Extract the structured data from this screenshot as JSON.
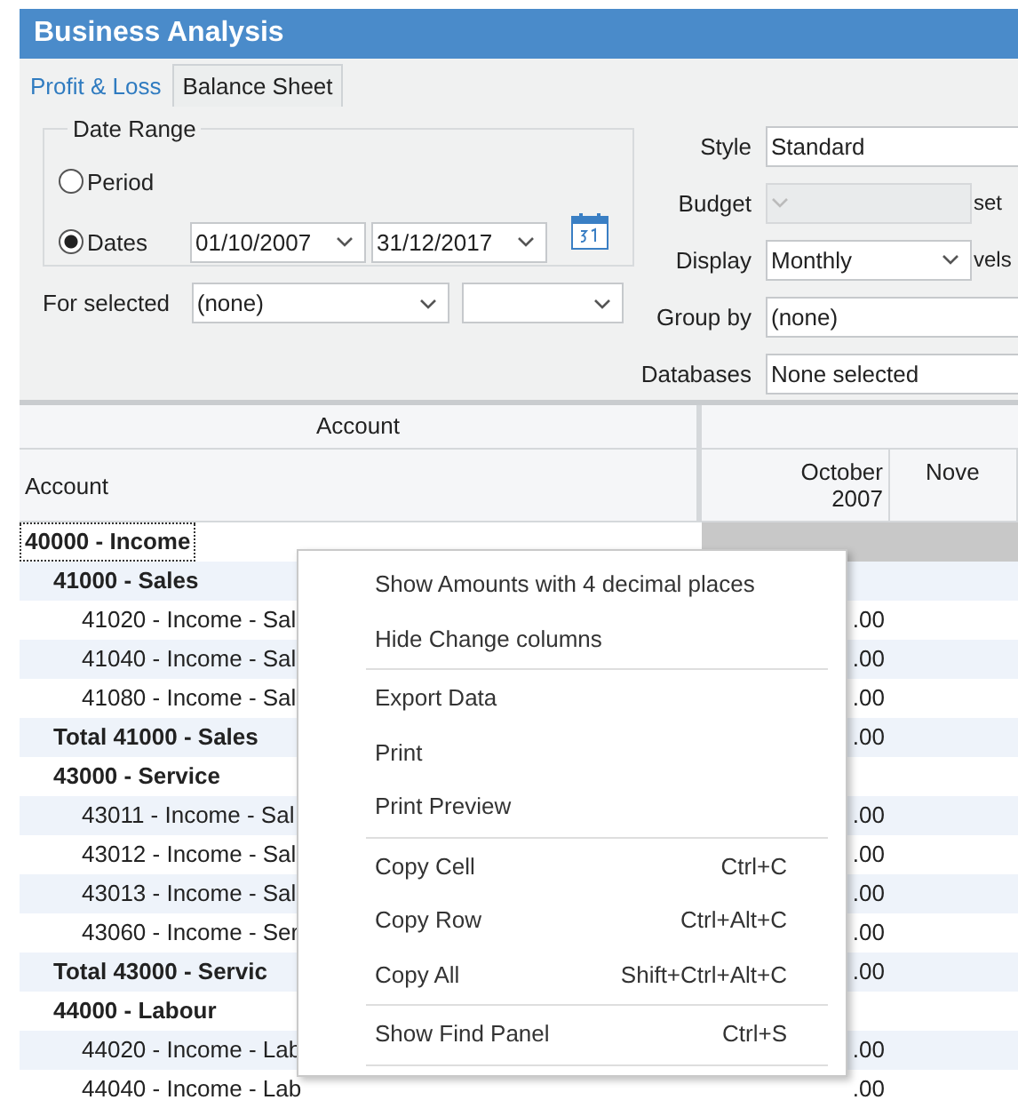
{
  "window": {
    "title": "Business Analysis"
  },
  "tabs": [
    {
      "label": "Profit & Loss",
      "selected": true
    },
    {
      "label": "Balance Sheet",
      "selected": false
    }
  ],
  "date_range": {
    "title": "Date Range",
    "options": [
      {
        "label": "Period",
        "selected": false
      },
      {
        "label": "Dates",
        "selected": true
      }
    ],
    "from": "01/10/2007",
    "to": "31/12/2017"
  },
  "for_selected": {
    "label": "For selected",
    "value": "(none)"
  },
  "settings": [
    {
      "label": "Style",
      "value": "Standard",
      "disabled": false,
      "chevron": false
    },
    {
      "label": "Budget",
      "disabled": true,
      "chevron": true,
      "trailing": "set"
    },
    {
      "label": "Display",
      "value": "Monthly",
      "disabled": false,
      "chevron": true,
      "trailing": "vels"
    },
    {
      "label": "Group by",
      "value": "(none)",
      "disabled": false,
      "chevron": false
    },
    {
      "label": "Databases",
      "value": "None selected",
      "disabled": false,
      "chevron": false
    }
  ],
  "table": {
    "band": "Account",
    "columns": [
      "Account",
      "October\n2007",
      "Nove"
    ],
    "rows": [
      {
        "kind": "heading",
        "label": "40000 - Income",
        "selected": true,
        "children": [
          {
            "kind": "heading",
            "label": "41000 - Sales",
            "selected": false,
            "children": [
              {
                "kind": "account",
                "label": "41020 - Income - Sal",
                "value": ".00",
                "selected": false
              },
              {
                "kind": "account",
                "label": "41040 - Income - Sal",
                "value": ".00",
                "selected": false
              },
              {
                "kind": "account",
                "label": "41080 - Income - Sal",
                "value": ".00",
                "selected": false
              }
            ]
          },
          {
            "kind": "heading",
            "label": "Total 41000 - Sales",
            "value": ".00",
            "selected": false
          },
          {
            "kind": "heading",
            "label": "43000 - Service",
            "selected": false,
            "children": [
              {
                "kind": "account",
                "label": "43011 - Income - Sal",
                "value": ".00",
                "selected": false
              },
              {
                "kind": "account",
                "label": "43012 - Income - Sal",
                "value": ".00",
                "selected": false
              },
              {
                "kind": "account",
                "label": "43013 - Income - Sal",
                "value": ".00",
                "selected": false
              },
              {
                "kind": "account",
                "label": "43060 - Income - Ser",
                "value": ".00",
                "selected": false
              }
            ]
          },
          {
            "kind": "heading",
            "label": "Total 43000 - Servic",
            "value": ".00",
            "selected": false
          },
          {
            "kind": "heading",
            "label": "44000 - Labour",
            "selected": false,
            "children": [
              {
                "kind": "account",
                "label": "44020 - Income - Lab",
                "value": ".00",
                "selected": false
              },
              {
                "kind": "account",
                "label": "44040 - Income - Lab",
                "value": ".00",
                "selected": false
              }
            ]
          }
        ]
      }
    ]
  },
  "context_menu": [
    {
      "kind": "item",
      "label": "Show Amounts with 4 decimal places"
    },
    {
      "kind": "item",
      "label": "Hide Change columns"
    },
    {
      "kind": "separator"
    },
    {
      "kind": "item",
      "label": "Export Data"
    },
    {
      "kind": "item",
      "label": "Print"
    },
    {
      "kind": "item",
      "label": "Print Preview"
    },
    {
      "kind": "separator"
    },
    {
      "kind": "item",
      "label": "Copy Cell",
      "shortcut": "Ctrl+C"
    },
    {
      "kind": "item",
      "label": "Copy Row",
      "shortcut": "Ctrl+Alt+C"
    },
    {
      "kind": "item",
      "label": "Copy All",
      "shortcut": "Shift+Ctrl+Alt+C"
    },
    {
      "kind": "separator"
    },
    {
      "kind": "item",
      "label": "Show Find Panel",
      "shortcut": "Ctrl+S"
    },
    {
      "kind": "separator"
    }
  ]
}
